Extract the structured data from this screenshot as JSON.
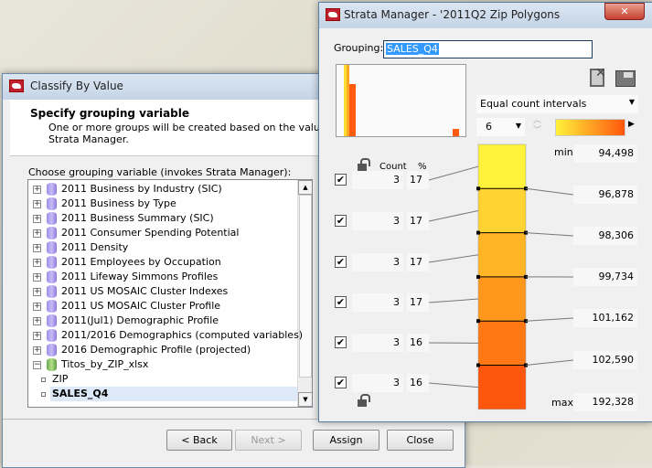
{
  "classify": {
    "title": "Classify By Value",
    "header_title": "Specify grouping variable",
    "header_desc_1": "One or more groups will be created based on the value criteria",
    "header_desc_2": "Strata Manager.",
    "list_label": "Choose grouping variable (invokes Strata Manager):",
    "items": [
      {
        "label": "2011 Business by Industry (SIC)",
        "type": "db"
      },
      {
        "label": "2011 Business by Type",
        "type": "db"
      },
      {
        "label": "2011 Business Summary (SIC)",
        "type": "db"
      },
      {
        "label": "2011 Consumer Spending Potential",
        "type": "db"
      },
      {
        "label": "2011 Density",
        "type": "db"
      },
      {
        "label": "2011 Employees by Occupation",
        "type": "db"
      },
      {
        "label": "2011 Lifeway Simmons Profiles",
        "type": "db"
      },
      {
        "label": "2011 US MOSAIC Cluster Indexes",
        "type": "db"
      },
      {
        "label": "2011 US MOSAIC Cluster Profile",
        "type": "db"
      },
      {
        "label": "2011(Jul1) Demographic Profile",
        "type": "db"
      },
      {
        "label": "2011/2016 Demographics (computed variables)",
        "type": "db"
      },
      {
        "label": "2016 Demographic Profile (projected)",
        "type": "db"
      },
      {
        "label": "Titos_by_ZIP_xlsx",
        "type": "sheet"
      },
      {
        "label": "ZIP",
        "type": "field"
      },
      {
        "label": "SALES_Q4",
        "type": "field",
        "selected": true
      }
    ],
    "buttons": {
      "back": "< Back",
      "next": "Next >",
      "assign": "Assign",
      "close": "Close"
    }
  },
  "strata": {
    "title": "Strata Manager - '2011Q2 Zip Polygons",
    "grouping_label": "Grouping:",
    "grouping_value": "SALES_Q4",
    "method": "Equal count intervals",
    "num_classes": "6",
    "count_header": "Count",
    "pct_header": "%",
    "min_label": "min",
    "max_label": "max",
    "min_value": "94,498",
    "max_value": "192,328",
    "breaks": [
      "96,878",
      "98,306",
      "99,734",
      "101,162",
      "102,590"
    ],
    "classes": [
      {
        "count": "3",
        "pct": "17",
        "checked": true,
        "color": "#fff23a"
      },
      {
        "count": "3",
        "pct": "17",
        "checked": true,
        "color": "#ffd331"
      },
      {
        "count": "3",
        "pct": "17",
        "checked": true,
        "color": "#ffb526"
      },
      {
        "count": "3",
        "pct": "17",
        "checked": true,
        "color": "#ff971c"
      },
      {
        "count": "3",
        "pct": "16",
        "checked": true,
        "color": "#ff7813"
      },
      {
        "count": "3",
        "pct": "16",
        "checked": true,
        "color": "#ff560d"
      }
    ],
    "ramp_start": "#fff23a",
    "ramp_end": "#ff560d"
  }
}
